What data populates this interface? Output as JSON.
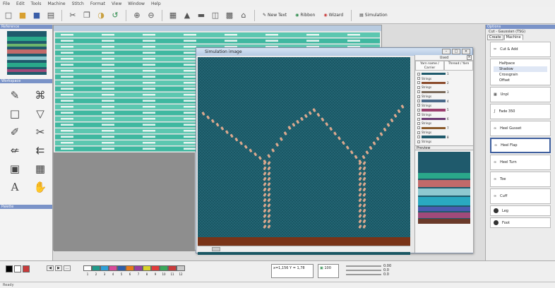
{
  "menus": [
    "File",
    "Edit",
    "Tools",
    "Machine",
    "Stitch",
    "Format",
    "View",
    "Window",
    "Help"
  ],
  "toolbar": {
    "new_text": "New Text",
    "ribbon_text": "Ribbon",
    "wizard_text": "Wizard",
    "simulation_text": "Simulation"
  },
  "left_panel": {
    "title_top": "Reference",
    "title_tools": "Workspace",
    "title_bottom": "Palette",
    "tools": [
      "pencil-icon",
      "eyedropper-icon",
      "rectangle-icon",
      "fill-icon",
      "brush-icon",
      "cut-icon",
      "stitch-icon",
      "move-icon",
      "square-icon",
      "grid-icon",
      "text-icon",
      "hand-icon"
    ]
  },
  "front_window": {
    "title": "Simulation image",
    "color_panel": {
      "header": "Used",
      "tabs": [
        "Yarn name / Carrier",
        "Thread / Yarn"
      ],
      "colors": [
        {
          "hex": "#1f5a6c",
          "num": "1"
        },
        {
          "hex": "#8a4a2a",
          "num": "2"
        },
        {
          "hex": "#7a6a5a",
          "num": "3"
        },
        {
          "hex": "#4b6a8a",
          "num": "4"
        },
        {
          "hex": "#9b3f6f",
          "num": "5"
        },
        {
          "hex": "#6b3a73",
          "num": "6"
        },
        {
          "hex": "#8a5a2a",
          "num": "7"
        },
        {
          "hex": "#1f5a6c",
          "num": "8"
        }
      ],
      "colors_label": "Strings",
      "preview_title": "Preview"
    }
  },
  "right_panel": {
    "title": "Options",
    "header": "Cut - Gaussian (TSG)",
    "tabs": [
      "Create",
      "Machine"
    ],
    "items": [
      {
        "label": "Cut & Add",
        "icon": "scissor-icon"
      },
      {
        "label": "Halfpace",
        "icon": "bar-icon"
      },
      {
        "label": "Unpl",
        "icon": "pattern-icon"
      },
      {
        "label": "Fade 350",
        "icon": "yarn-icon"
      },
      {
        "label": "Heel Gusset",
        "icon": "loop-icon"
      },
      {
        "label": "Heel Flap",
        "icon": "loop-icon"
      },
      {
        "label": "Heel Turn",
        "icon": "loop-icon"
      },
      {
        "label": "Toe",
        "icon": "loop-icon"
      },
      {
        "label": "Cuff",
        "icon": "loop-icon"
      },
      {
        "label": "Leg",
        "icon": "dot-icon"
      },
      {
        "label": "Foot",
        "icon": "dot-icon"
      }
    ],
    "menu": [
      "Shadow",
      "Crossgrain",
      "Offset"
    ]
  },
  "bottom": {
    "palette": [
      {
        "hex": "#ffffff",
        "num": "1"
      },
      {
        "hex": "#1f9a8a",
        "num": "2"
      },
      {
        "hex": "#2ea0d8",
        "num": "3"
      },
      {
        "hex": "#d84a9a",
        "num": "4"
      },
      {
        "hex": "#2f5ea8",
        "num": "5"
      },
      {
        "hex": "#e87a1a",
        "num": "6"
      },
      {
        "hex": "#9a3fa0",
        "num": "7"
      },
      {
        "hex": "#d8d22a",
        "num": "8"
      },
      {
        "hex": "#e23a3a",
        "num": "9"
      },
      {
        "hex": "#3aa85a",
        "num": "10"
      },
      {
        "hex": "#c83a3a",
        "num": "11"
      },
      {
        "hex": "#c8c8c8",
        "num": "12"
      }
    ],
    "coords": "x=1,156 Y = 1,78",
    "zoom": "100",
    "meters": [
      "0.00",
      "0.0",
      "0.0"
    ],
    "status": "Ready"
  }
}
